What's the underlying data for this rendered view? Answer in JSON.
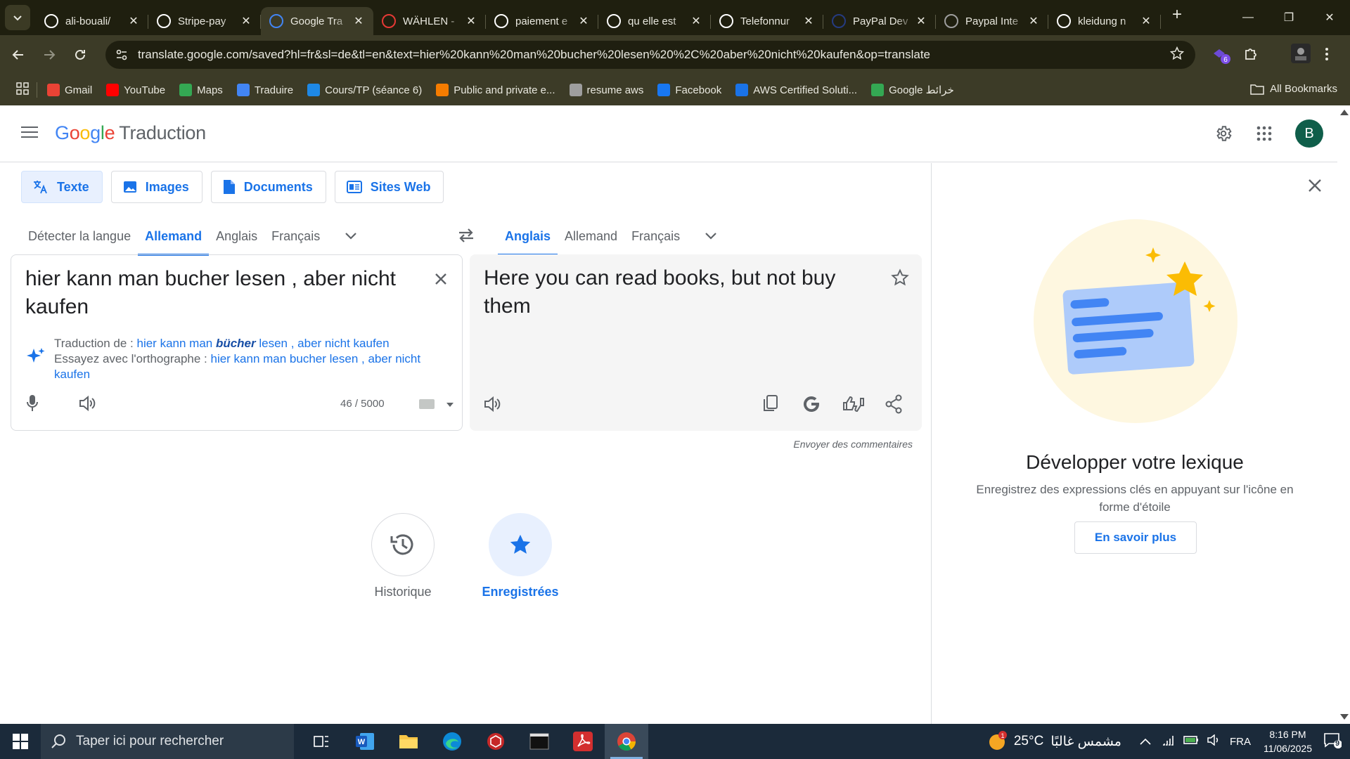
{
  "browser": {
    "tabs": [
      {
        "title": "ali-bouali/",
        "icon": "github-icon",
        "color": "#ffffff"
      },
      {
        "title": "Stripe-pay",
        "icon": "github-icon",
        "color": "#ffffff"
      },
      {
        "title": "Google Tra",
        "icon": "google-translate-icon",
        "color": "#4285f4",
        "active": true
      },
      {
        "title": "WÄHLEN -",
        "icon": "g-red-icon",
        "color": "#e53935"
      },
      {
        "title": "paiement e",
        "icon": "google-icon",
        "color": "#ffffff"
      },
      {
        "title": "qu elle est",
        "icon": "google-icon",
        "color": "#ffffff"
      },
      {
        "title": "Telefonnur",
        "icon": "chatgpt-icon",
        "color": "#ffffff"
      },
      {
        "title": "PayPal Dev",
        "icon": "paypal-icon",
        "color": "#253b80"
      },
      {
        "title": "Paypal Inte",
        "icon": "globe-icon",
        "color": "#9e9e9e"
      },
      {
        "title": "kleidung n",
        "icon": "google-icon",
        "color": "#ffffff"
      }
    ],
    "url": "translate.google.com/saved?hl=fr&sl=de&tl=en&text=hier%20kann%20man%20bucher%20lesen%20%2C%20aber%20nicht%20kaufen&op=translate",
    "extension_badge": "6",
    "bookmarks": [
      {
        "label": "Gmail",
        "icon": "gmail-icon",
        "color": "#ea4335"
      },
      {
        "label": "YouTube",
        "icon": "youtube-icon",
        "color": "#ff0000"
      },
      {
        "label": "Maps",
        "icon": "maps-icon",
        "color": "#34a853"
      },
      {
        "label": "Traduire",
        "icon": "google-translate-icon",
        "color": "#4285f4"
      },
      {
        "label": "Cours/TP (séance 6)",
        "icon": "classroom-icon",
        "color": "#1e88e5"
      },
      {
        "label": "Public and private e...",
        "icon": "p-icon",
        "color": "#f57c00"
      },
      {
        "label": "resume aws",
        "icon": "globe-icon",
        "color": "#9e9e9e"
      },
      {
        "label": "Facebook",
        "icon": "facebook-icon",
        "color": "#1877f2"
      },
      {
        "label": "AWS Certified Soluti...",
        "icon": "aws-icon",
        "color": "#1a73e8"
      },
      {
        "label": "Google خرائط",
        "icon": "maps-icon",
        "color": "#34a853"
      }
    ],
    "all_bookmarks": "All Bookmarks"
  },
  "header": {
    "logo_google": "Google",
    "logo_product": "Traduction",
    "avatar_letter": "B"
  },
  "modes": [
    {
      "label": "Texte",
      "active": true
    },
    {
      "label": "Images"
    },
    {
      "label": "Documents"
    },
    {
      "label": "Sites Web"
    }
  ],
  "source_langs": [
    "Détecter la langue",
    "Allemand",
    "Anglais",
    "Français"
  ],
  "source_active": 1,
  "target_langs": [
    "Anglais",
    "Allemand",
    "Français"
  ],
  "target_active": 0,
  "source": {
    "text": "hier kann man bucher lesen , aber nicht kaufen",
    "suggest_prefix_1": "Traduction de : ",
    "suggest_link_1_a": "hier kann man ",
    "suggest_link_1_b": "bücher",
    "suggest_link_1_c": " lesen , aber nicht kaufen",
    "suggest_prefix_2": "Essayez avec l'orthographe : ",
    "suggest_link_2": "hier kann man bucher lesen , aber nicht kaufen",
    "char_count": "46 / 5000"
  },
  "target": {
    "text": "Here you can read books, but not buy them",
    "feedback": "Envoyer des commentaires"
  },
  "bottom": {
    "history": "Historique",
    "saved": "Enregistrées"
  },
  "side_panel": {
    "title": "Développer votre lexique",
    "description": "Enregistrez des expressions clés en appuyant sur l'icône en forme d'étoile",
    "button": "En savoir plus"
  },
  "taskbar": {
    "search_placeholder": "Taper ici pour rechercher",
    "weather_temp": "25°C",
    "weather_text": "مشمس غالبًا",
    "weather_badge": "1",
    "language": "FRA",
    "time": "8:16 PM",
    "date": "11/06/2025",
    "notifications": "9"
  },
  "colors": {
    "accent": "#1a73e8",
    "chrome_dark": "#1f1f0f",
    "chrome": "#3c3b27",
    "taskbar": "#1b2a3a"
  }
}
